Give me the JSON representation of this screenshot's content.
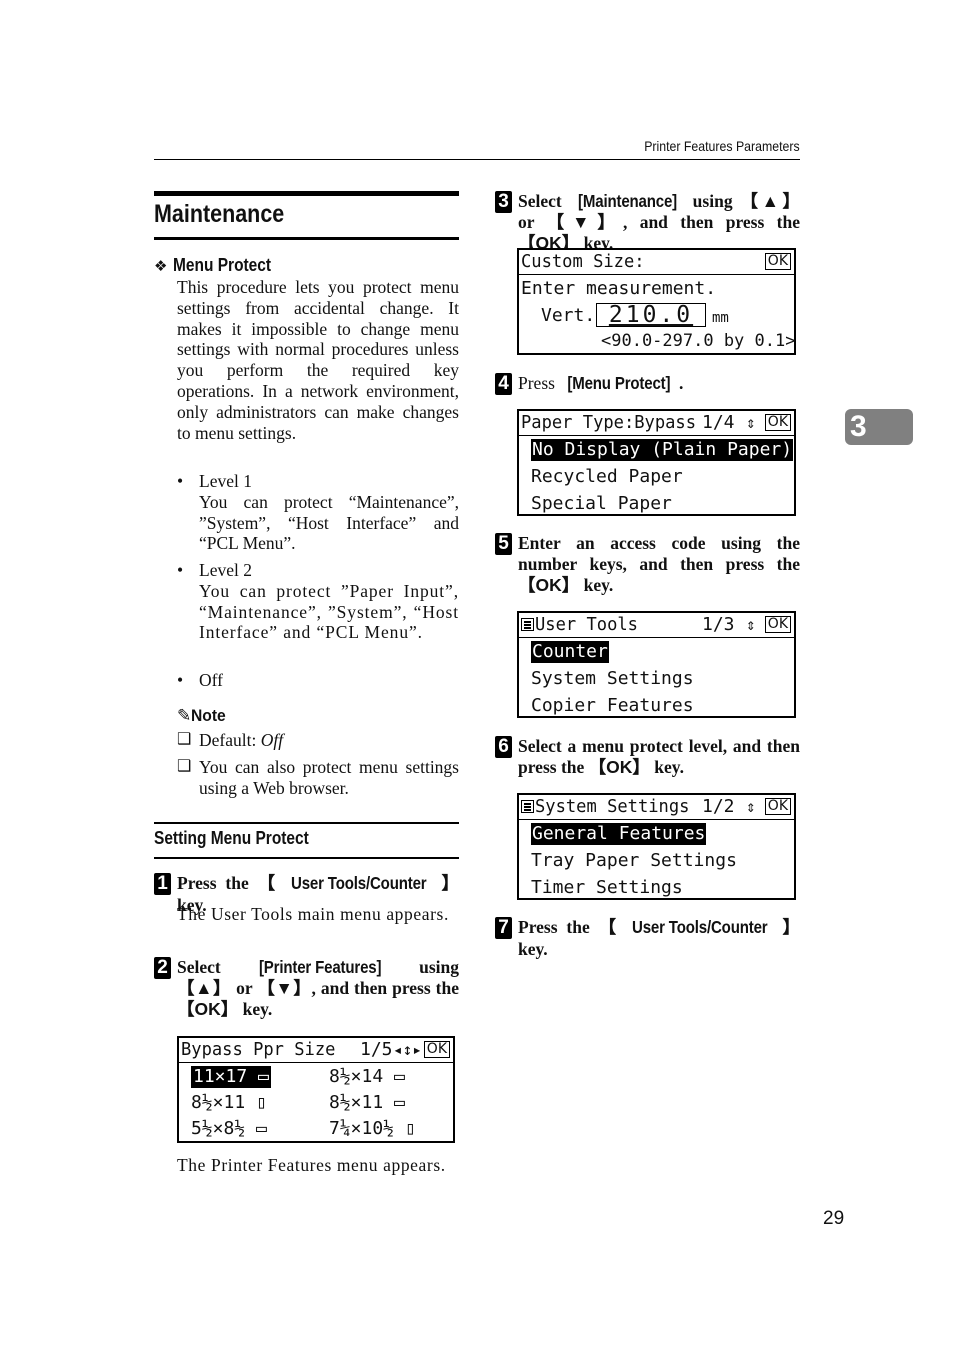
{
  "header": {
    "running_title": "Printer Features Parameters"
  },
  "section": {
    "title": "Maintenance",
    "subsection": {
      "title": "Menu Protect",
      "intro": "This procedure lets you protect menu settings from accidental change. It makes it impossible to change menu settings with normal procedures unless you perform the required key operations. In a network environment, only administrators can make changes to menu settings.",
      "levels": [
        {
          "label": "Level 1",
          "desc": "You can protect “Maintenance”, ”System”, “Host Interface” and “PCL Menu”."
        },
        {
          "label": "Level 2",
          "desc": "You can protect ”Paper Input”, “Maintenance”, ”System”, “Host Interface” and “PCL Menu”."
        },
        {
          "label": "Off",
          "desc": ""
        }
      ],
      "note": {
        "title": "Note",
        "icon": "pencil-icon",
        "items": [
          {
            "prefix": "Default: ",
            "value": "Off"
          },
          {
            "prefix": "You can also protect menu settings using a Web browser.",
            "value": ""
          }
        ]
      }
    },
    "procedure_title": "Setting Menu Protect"
  },
  "steps": [
    {
      "number": "1",
      "parts": [
        "Press the ",
        "【",
        "User Tools/Counter",
        "】",
        " key."
      ],
      "desc": "The User Tools main menu appears."
    },
    {
      "number": "2",
      "parts": [
        "Select ",
        "[Printer Features]",
        " using ",
        "【▲】",
        " or ",
        "【▼】",
        ", and then press the ",
        "【OK】",
        " key."
      ],
      "desc": "The Printer Features menu appears."
    },
    {
      "number": "3",
      "parts": [
        "Select ",
        "[Maintenance]",
        " using ",
        "【▲】",
        " or ",
        "【▼】",
        ", and then press the ",
        "【OK】",
        " key."
      ]
    },
    {
      "number": "4",
      "parts": [
        "Press ",
        "[Menu Protect]",
        "."
      ]
    },
    {
      "number": "5",
      "parts": [
        "Enter an access code using the number keys, and then press the ",
        "【OK】",
        " key."
      ]
    },
    {
      "number": "6",
      "parts": [
        "Select a menu protect level, and then press the ",
        "【OK】",
        " key."
      ]
    },
    {
      "number": "7",
      "parts": [
        "Press the ",
        "【",
        "User Tools/Counter",
        "】",
        " key."
      ]
    }
  ],
  "screens": {
    "bypass": {
      "title": "Bypass Ppr Size",
      "page": "1/5",
      "ok": "OK",
      "cells": [
        "11×17",
        "8½×14",
        "8½×11",
        "8½×11",
        "5½×8½",
        "7¼×10½"
      ],
      "selected_index": 0
    },
    "custom_size": {
      "title": "Custom Size:",
      "ok": "OK",
      "line1": "Enter measurement.",
      "label": "Vert.",
      "value": "210.0",
      "unit": "mm",
      "range": "<90.0-297.0 by 0.1>"
    },
    "paper_type": {
      "title": "Paper Type:Bypass",
      "page": "1/4",
      "ok": "OK",
      "items": [
        "No Display (Plain Paper)",
        "Recycled Paper",
        "Special Paper"
      ],
      "selected_index": 0
    },
    "user_tools": {
      "title": "User Tools",
      "page": "1/3",
      "ok": "OK",
      "items": [
        "Counter",
        "System Settings",
        "Copier Features"
      ],
      "selected_index": 0
    },
    "system_settings": {
      "title": "System Settings",
      "page": "1/2",
      "ok": "OK",
      "items": [
        "General Features",
        "Tray Paper Settings",
        "Timer Settings"
      ],
      "selected_index": 0
    }
  },
  "chapter_tab": "3",
  "page_number": "29"
}
